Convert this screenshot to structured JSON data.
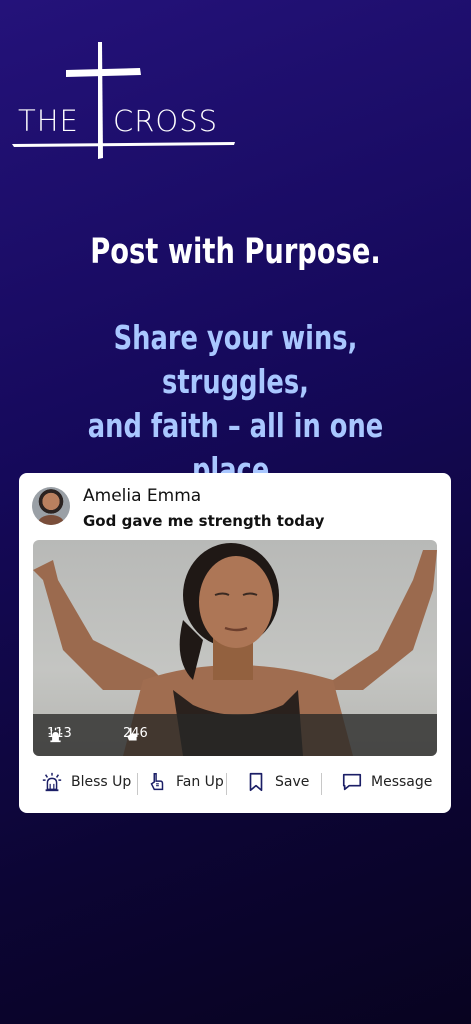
{
  "logo": {
    "word_left": "THE",
    "word_right": "CROSS"
  },
  "headline": "Post with Purpose.",
  "subline": {
    "line1": "Share your wins, struggles,",
    "line2": "and faith – all in one place."
  },
  "post": {
    "author": "Amelia Emma",
    "caption": "God gave me strength today",
    "stats": {
      "bless_count": "113",
      "fan_count": "246"
    },
    "actions": {
      "bless_label": "Bless Up",
      "fan_label": "Fan Up",
      "save_label": "Save",
      "message_label": "Message"
    }
  },
  "colors": {
    "accent": "#a9c7ff",
    "background": "#1a0c66"
  },
  "icons": [
    "cross-logo-icon",
    "bless-up-icon",
    "fan-up-icon",
    "bookmark-icon",
    "message-icon"
  ]
}
